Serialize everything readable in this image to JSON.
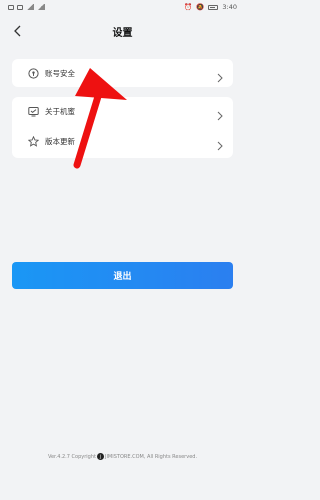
{
  "status_bar": {
    "time": "3:40",
    "battery_icon": "battery-icon",
    "signal_icon": "signal-icon"
  },
  "header": {
    "title": "设置",
    "back_icon": "chevron-left-icon"
  },
  "settings_groups": [
    {
      "items": [
        {
          "label": "账号安全",
          "icon": "account-security-icon"
        }
      ]
    },
    {
      "items": [
        {
          "label": "关于机蜜",
          "icon": "about-icon"
        },
        {
          "label": "版本更新",
          "icon": "version-update-icon"
        }
      ]
    }
  ],
  "logout": {
    "label": "退出"
  },
  "footer": {
    "text_before": "Ver.4.2.7 Copyright",
    "text_after": "JIMISTORE.COM, All Rights Reserved."
  },
  "colors": {
    "accent": "#2b8cf3",
    "background": "#f2f3f5",
    "annotation_arrow": "#ee1111"
  }
}
